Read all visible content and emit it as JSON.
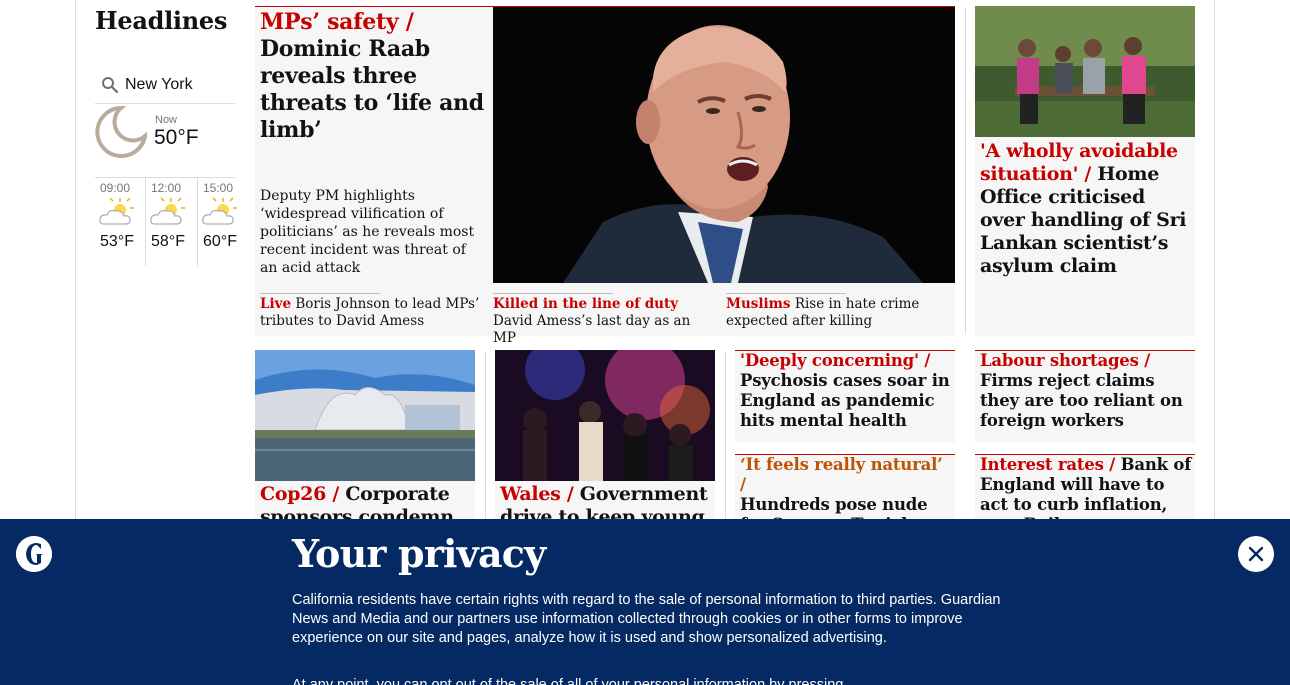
{
  "section": {
    "title": "Headlines"
  },
  "weather": {
    "location": "New York",
    "now_label": "Now",
    "now_temp": "50°F",
    "forecast": [
      {
        "time": "09:00",
        "temp": "53°F",
        "icon": "partly-cloudy-icon"
      },
      {
        "time": "12:00",
        "temp": "58°F",
        "icon": "partly-cloudy-icon"
      },
      {
        "time": "15:00",
        "temp": "60°F",
        "icon": "partly-cloudy-icon"
      }
    ]
  },
  "main": {
    "kicker": "MPs’ safety /",
    "headline": "Dominic Raab reveals three threats to ‘life and limb’",
    "standfirst": "Deputy PM highlights ‘widespread vilification of politicians’ as he reveals most recent incident was threat of an acid attack",
    "sublinks": [
      {
        "kicker": "Live",
        "text": "Boris Johnson to lead MPs’ tributes to David Amess"
      },
      {
        "kicker": "Killed in the line of duty",
        "text": "David Amess’s last day as an MP"
      },
      {
        "kicker": "Muslims",
        "text": "Rise in hate crime expected after killing"
      }
    ]
  },
  "right_top": {
    "kicker": "'A wholly avoidable situation' /",
    "headline": "Home Office criticised over handling of Sri Lankan scientist’s asylum claim"
  },
  "row2": {
    "cop26": {
      "kicker": "Cop26 /",
      "headline": "Corporate sponsors condemn"
    },
    "wales": {
      "kicker": "Wales /",
      "headline": "Government drive to keep young"
    },
    "psychosis": {
      "kicker": "'Deeply concerning' /",
      "headline": "Psychosis cases soar in England as pandemic hits mental health"
    },
    "tunick": {
      "kicker": "‘It feels really natural’ /",
      "headline": "Hundreds pose nude for Spencer Tunick shoot near Dead Sea"
    },
    "labour": {
      "kicker": "Labour shortages /",
      "headline": "Firms reject claims they are too reliant on foreign workers"
    },
    "interest": {
      "kicker": "Interest rates /",
      "headline": "Bank of England will have to act to curb inflation, says Bailey"
    }
  },
  "privacy": {
    "title": "Your privacy",
    "body": "California residents have certain rights with regard to the sale of personal information to third parties. Guardian News and Media and our partners use information collected through cookies or in other forms to improve experience on our site and pages, analyze how it is used and show personalized advertising.",
    "body2": "At any point, you can opt out of the sale of all of your personal information by pressing"
  },
  "colors": {
    "news_red": "#c70000",
    "privacy_bg": "#052962",
    "card_bg": "#f6f6f6"
  }
}
